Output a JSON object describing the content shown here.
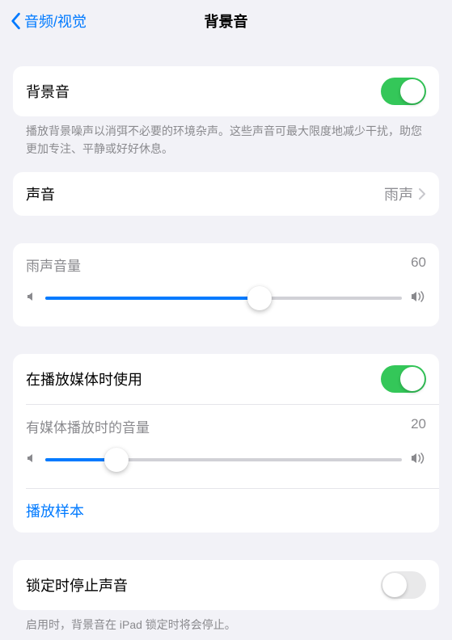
{
  "nav": {
    "back_label": "音频/视觉",
    "title": "背景音"
  },
  "main_toggle": {
    "label": "背景音",
    "on": true,
    "description": "播放背景噪声以消弭不必要的环境杂声。这些声音可最大限度地减少干扰，助您更加专注、平静或好好休息。"
  },
  "sound_row": {
    "label": "声音",
    "value": "雨声"
  },
  "volume1": {
    "label": "雨声音量",
    "value": 60
  },
  "media_toggle": {
    "label": "在播放媒体时使用",
    "on": true
  },
  "volume2": {
    "label": "有媒体播放时的音量",
    "value": 20
  },
  "play_sample": "播放样本",
  "lock_toggle": {
    "label": "锁定时停止声音",
    "on": false,
    "description": "启用时，背景音在 iPad 锁定时将会停止。"
  }
}
